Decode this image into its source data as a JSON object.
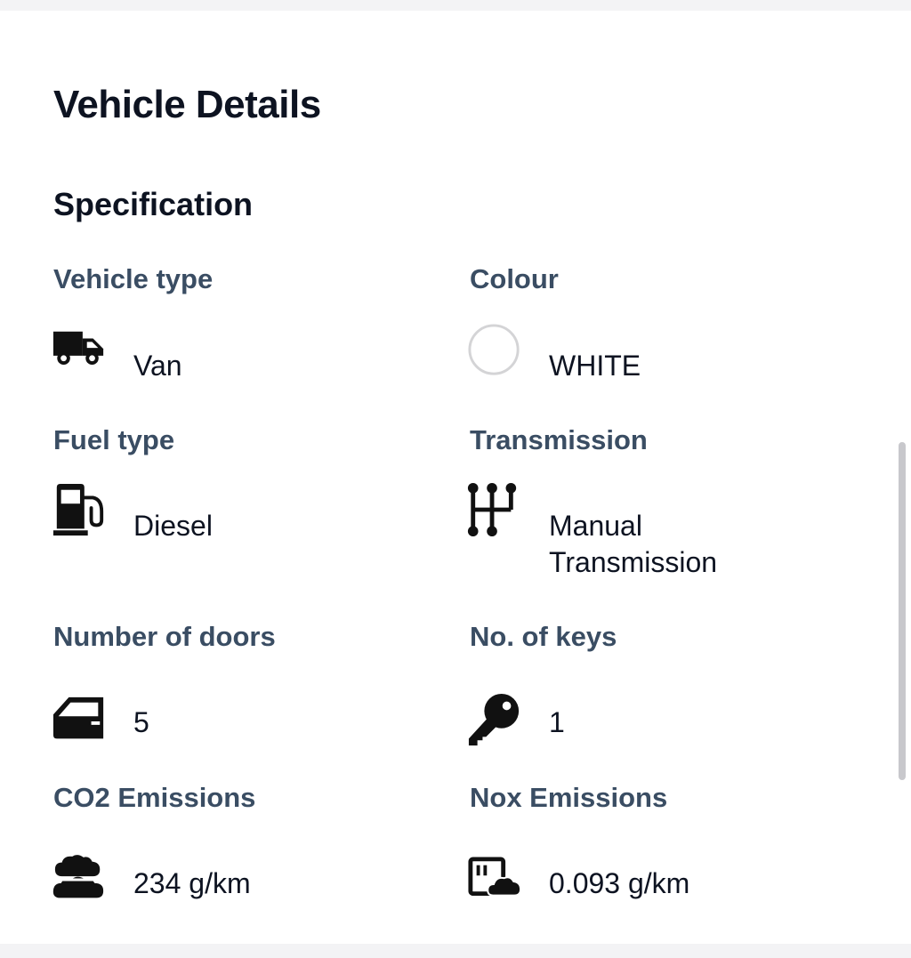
{
  "page": {
    "title": "Vehicle Details"
  },
  "specification": {
    "title": "Specification",
    "items": [
      {
        "label": "Vehicle type",
        "value": "Van",
        "icon": "van-icon"
      },
      {
        "label": "Colour",
        "value": "WHITE",
        "icon": "color-swatch-icon",
        "swatch_color": "#ffffff"
      },
      {
        "label": "Fuel type",
        "value": "Diesel",
        "icon": "fuel-pump-icon"
      },
      {
        "label": "Transmission",
        "value": "Manual Transmission",
        "icon": "gear-shift-icon"
      },
      {
        "label": "Number of doors",
        "value": "5",
        "icon": "car-door-icon"
      },
      {
        "label": "No. of keys",
        "value": "1",
        "icon": "key-icon"
      },
      {
        "label": "CO2 Emissions",
        "value": "234 g/km",
        "icon": "cloud-emissions-icon"
      },
      {
        "label": "Nox Emissions",
        "value": "0.093 g/km",
        "icon": "exhaust-emissions-icon"
      }
    ]
  },
  "colors": {
    "title_text": "#0d1321",
    "label_text": "#3a4d63",
    "icon": "#111111",
    "background": "#ffffff"
  }
}
